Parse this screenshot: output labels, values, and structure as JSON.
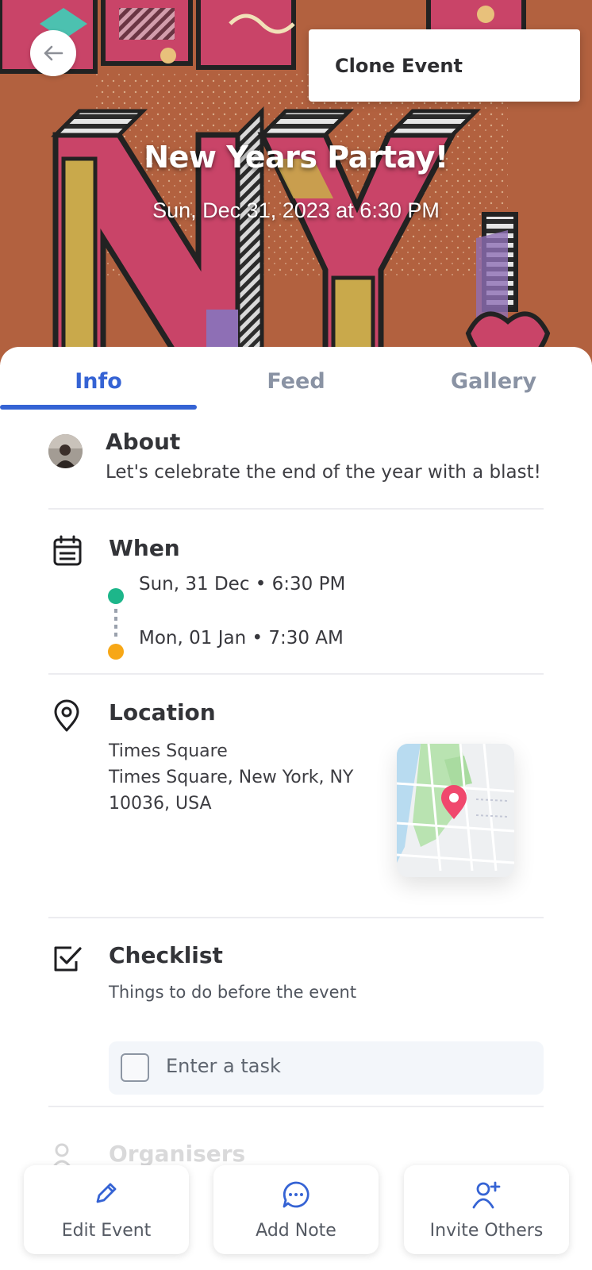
{
  "header": {
    "back_icon": "arrow-left-icon",
    "menu": {
      "clone_label": "Clone Event"
    },
    "event_title": "New Years Partay!",
    "event_datetime": "Sun, Dec 31, 2023 at 6:30 PM"
  },
  "tabs": [
    {
      "label": "Info",
      "active": true
    },
    {
      "label": "Feed",
      "active": false
    },
    {
      "label": "Gallery",
      "active": false
    }
  ],
  "about": {
    "title": "About",
    "text": "Let's celebrate the end of the year with a blast!"
  },
  "when": {
    "title": "When",
    "icon": "calendar-icon",
    "start": "Sun, 31 Dec • 6:30 PM",
    "end": "Mon, 01 Jan • 7:30 AM"
  },
  "location": {
    "title": "Location",
    "icon": "map-pin-icon",
    "name": "Times Square",
    "address_line1": "Times Square, New York, NY",
    "address_line2": "10036, USA"
  },
  "checklist": {
    "title": "Checklist",
    "icon": "checkbox-icon",
    "subtitle": "Things to do before the event",
    "task_placeholder": "Enter a task"
  },
  "organisers": {
    "title": "Organisers"
  },
  "actions": [
    {
      "label": "Edit Event",
      "icon": "pencil-icon"
    },
    {
      "label": "Add Note",
      "icon": "chat-bubble-icon"
    },
    {
      "label": "Invite Others",
      "icon": "add-user-icon"
    }
  ],
  "colors": {
    "accent": "#3563d4",
    "start_dot": "#1db68a",
    "end_dot": "#f7a716",
    "map_pin": "#f0486d"
  }
}
